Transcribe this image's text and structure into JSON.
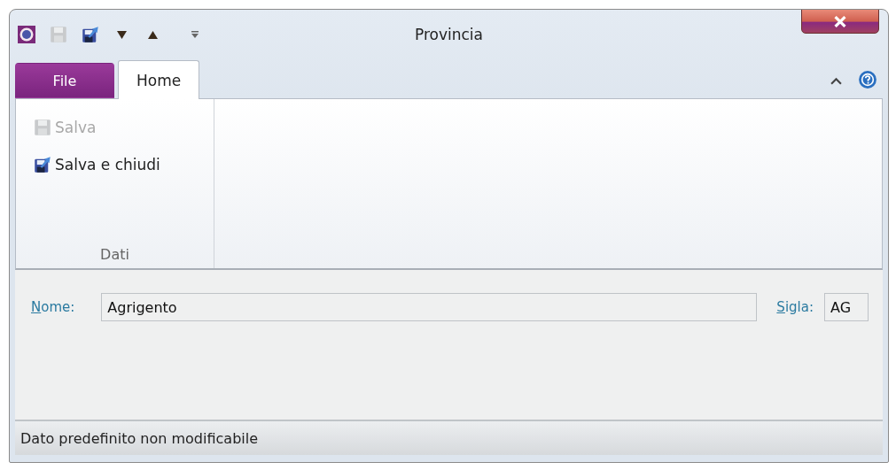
{
  "window": {
    "title": "Provincia"
  },
  "quick_access": [
    {
      "kind": "save",
      "disabled": true
    },
    {
      "kind": "save-close",
      "disabled": false
    },
    {
      "kind": "down",
      "disabled": false
    },
    {
      "kind": "up",
      "disabled": false
    },
    {
      "kind": "customize",
      "disabled": false
    }
  ],
  "tabs": [
    {
      "label": "File",
      "kind": "file",
      "selected": false
    },
    {
      "label": "Home",
      "kind": "tab",
      "selected": true
    }
  ],
  "ribbon_groups": [
    {
      "label": "Dati",
      "buttons": [
        {
          "label": "Salva",
          "kind": "save",
          "disabled": true
        },
        {
          "label": "Salva e chiudi",
          "kind": "save-close",
          "disabled": false
        }
      ]
    }
  ],
  "form": {
    "fields": [
      {
        "label": "Nome:",
        "value": "Agrigento",
        "kind": "wide"
      },
      {
        "label": "Sigla:",
        "value": "AG",
        "kind": "short"
      }
    ]
  },
  "status_bar": "Dato predefinito non modificabile"
}
